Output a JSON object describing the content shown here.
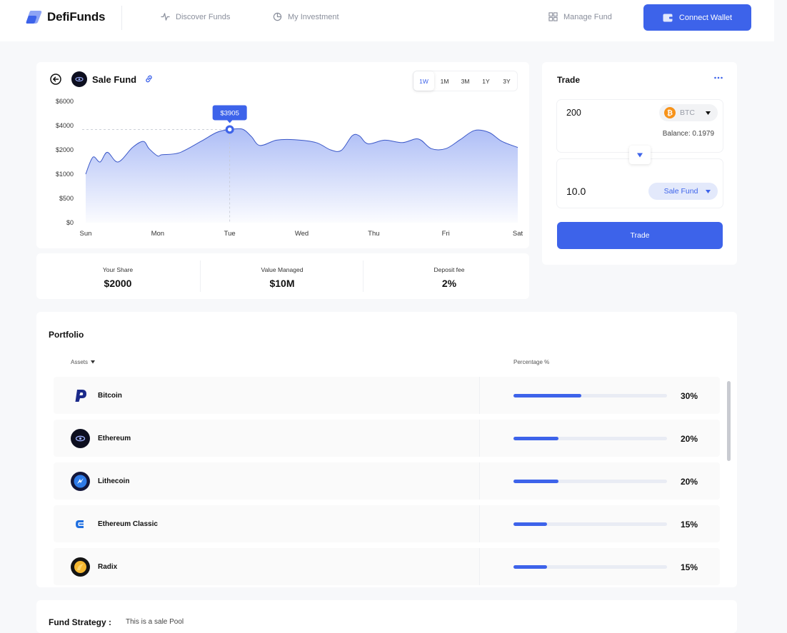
{
  "brand": {
    "name": "DefiFunds",
    "accent": "#3d63ea"
  },
  "nav": {
    "links": [
      {
        "label": "Discover Funds",
        "icon": "activity-icon"
      },
      {
        "label": "My Investment",
        "icon": "pie-chart-icon"
      },
      {
        "label": "Manage Fund",
        "icon": "grid-icon"
      }
    ],
    "connect_wallet": "Connect Wallet"
  },
  "fund": {
    "title": "Sale Fund"
  },
  "range_tabs": [
    "1W",
    "1M",
    "3M",
    "1Y",
    "3Y"
  ],
  "active_range": "1W",
  "chart_data": {
    "type": "area",
    "x": [
      "Sun",
      "Mon",
      "Tue",
      "Wed",
      "Thu",
      "Fri",
      "Sat"
    ],
    "y_ticks": [
      "$0",
      "$500",
      "$1000",
      "$2000",
      "$4000",
      "$6000"
    ],
    "points": [
      [
        0,
        2.0
      ],
      [
        0.1,
        2.7
      ],
      [
        0.2,
        2.5
      ],
      [
        0.3,
        2.9
      ],
      [
        0.45,
        2.5
      ],
      [
        0.65,
        3.1
      ],
      [
        0.8,
        3.35
      ],
      [
        0.88,
        3.05
      ],
      [
        1.0,
        2.75
      ],
      [
        1.06,
        2.8
      ],
      [
        1.3,
        2.88
      ],
      [
        1.6,
        3.35
      ],
      [
        1.82,
        3.72
      ],
      [
        2.0,
        3.84
      ],
      [
        2.18,
        3.85
      ],
      [
        2.3,
        3.55
      ],
      [
        2.42,
        3.18
      ],
      [
        2.65,
        3.4
      ],
      [
        2.9,
        3.42
      ],
      [
        3.2,
        3.3
      ],
      [
        3.4,
        3.0
      ],
      [
        3.55,
        2.98
      ],
      [
        3.7,
        3.58
      ],
      [
        3.8,
        3.58
      ],
      [
        3.92,
        3.25
      ],
      [
        4.15,
        3.4
      ],
      [
        4.4,
        3.3
      ],
      [
        4.62,
        3.45
      ],
      [
        4.8,
        3.05
      ],
      [
        5.0,
        3.05
      ],
      [
        5.2,
        3.42
      ],
      [
        5.4,
        3.8
      ],
      [
        5.6,
        3.72
      ],
      [
        5.78,
        3.35
      ],
      [
        6.0,
        3.1
      ]
    ],
    "highlight": {
      "x": 2.0,
      "label": "$3905"
    },
    "color": "#3d63ea",
    "grid": false
  },
  "stats": [
    {
      "label": "Your Share",
      "value": "$2000"
    },
    {
      "label": "Value Managed",
      "value": "$10M"
    },
    {
      "label": "Deposit fee",
      "value": "2%"
    }
  ],
  "trade": {
    "title": "Trade",
    "from_amount": "200",
    "from_token": "BTC",
    "balance": "Balance: 0.1979",
    "to_amount": "10.0",
    "to_token": "Sale Fund",
    "button": "Trade"
  },
  "portfolio": {
    "title": "Portfolio",
    "col_assets": "Assets",
    "col_percentage": "Percentage %",
    "assets": [
      {
        "name": "Bitcoin",
        "percent": 30,
        "label": "30%",
        "icon": "bitcoin-p-icon"
      },
      {
        "name": "Ethereum",
        "percent": 20,
        "label": "20%",
        "icon": "ethereum-icon"
      },
      {
        "name": "Lithecoin",
        "percent": 20,
        "label": "20%",
        "icon": "lithecoin-icon"
      },
      {
        "name": "Ethereum Classic",
        "percent": 15,
        "label": "15%",
        "icon": "ethereum-classic-icon"
      },
      {
        "name": "Radix",
        "percent": 15,
        "label": "15%",
        "icon": "radix-icon"
      }
    ]
  },
  "strategy": {
    "label": "Fund Strategy :",
    "text": "This is a sale Pool"
  }
}
